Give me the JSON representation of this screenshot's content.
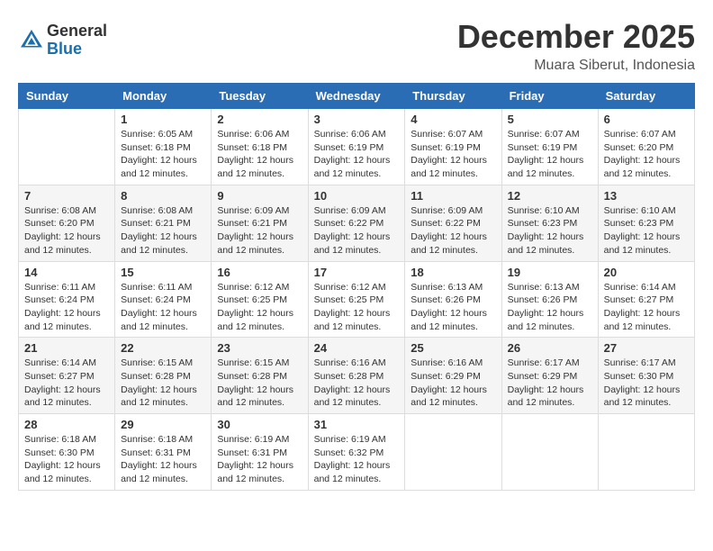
{
  "header": {
    "logo": {
      "general": "General",
      "blue": "Blue"
    },
    "title": "December 2025",
    "location": "Muara Siberut, Indonesia"
  },
  "columns": [
    "Sunday",
    "Monday",
    "Tuesday",
    "Wednesday",
    "Thursday",
    "Friday",
    "Saturday"
  ],
  "weeks": [
    [
      {
        "day": "",
        "info": ""
      },
      {
        "day": "1",
        "info": "Sunrise: 6:05 AM\nSunset: 6:18 PM\nDaylight: 12 hours\nand 12 minutes."
      },
      {
        "day": "2",
        "info": "Sunrise: 6:06 AM\nSunset: 6:18 PM\nDaylight: 12 hours\nand 12 minutes."
      },
      {
        "day": "3",
        "info": "Sunrise: 6:06 AM\nSunset: 6:19 PM\nDaylight: 12 hours\nand 12 minutes."
      },
      {
        "day": "4",
        "info": "Sunrise: 6:07 AM\nSunset: 6:19 PM\nDaylight: 12 hours\nand 12 minutes."
      },
      {
        "day": "5",
        "info": "Sunrise: 6:07 AM\nSunset: 6:19 PM\nDaylight: 12 hours\nand 12 minutes."
      },
      {
        "day": "6",
        "info": "Sunrise: 6:07 AM\nSunset: 6:20 PM\nDaylight: 12 hours\nand 12 minutes."
      }
    ],
    [
      {
        "day": "7",
        "info": "Sunrise: 6:08 AM\nSunset: 6:20 PM\nDaylight: 12 hours\nand 12 minutes."
      },
      {
        "day": "8",
        "info": "Sunrise: 6:08 AM\nSunset: 6:21 PM\nDaylight: 12 hours\nand 12 minutes."
      },
      {
        "day": "9",
        "info": "Sunrise: 6:09 AM\nSunset: 6:21 PM\nDaylight: 12 hours\nand 12 minutes."
      },
      {
        "day": "10",
        "info": "Sunrise: 6:09 AM\nSunset: 6:22 PM\nDaylight: 12 hours\nand 12 minutes."
      },
      {
        "day": "11",
        "info": "Sunrise: 6:09 AM\nSunset: 6:22 PM\nDaylight: 12 hours\nand 12 minutes."
      },
      {
        "day": "12",
        "info": "Sunrise: 6:10 AM\nSunset: 6:23 PM\nDaylight: 12 hours\nand 12 minutes."
      },
      {
        "day": "13",
        "info": "Sunrise: 6:10 AM\nSunset: 6:23 PM\nDaylight: 12 hours\nand 12 minutes."
      }
    ],
    [
      {
        "day": "14",
        "info": "Sunrise: 6:11 AM\nSunset: 6:24 PM\nDaylight: 12 hours\nand 12 minutes."
      },
      {
        "day": "15",
        "info": "Sunrise: 6:11 AM\nSunset: 6:24 PM\nDaylight: 12 hours\nand 12 minutes."
      },
      {
        "day": "16",
        "info": "Sunrise: 6:12 AM\nSunset: 6:25 PM\nDaylight: 12 hours\nand 12 minutes."
      },
      {
        "day": "17",
        "info": "Sunrise: 6:12 AM\nSunset: 6:25 PM\nDaylight: 12 hours\nand 12 minutes."
      },
      {
        "day": "18",
        "info": "Sunrise: 6:13 AM\nSunset: 6:26 PM\nDaylight: 12 hours\nand 12 minutes."
      },
      {
        "day": "19",
        "info": "Sunrise: 6:13 AM\nSunset: 6:26 PM\nDaylight: 12 hours\nand 12 minutes."
      },
      {
        "day": "20",
        "info": "Sunrise: 6:14 AM\nSunset: 6:27 PM\nDaylight: 12 hours\nand 12 minutes."
      }
    ],
    [
      {
        "day": "21",
        "info": "Sunrise: 6:14 AM\nSunset: 6:27 PM\nDaylight: 12 hours\nand 12 minutes."
      },
      {
        "day": "22",
        "info": "Sunrise: 6:15 AM\nSunset: 6:28 PM\nDaylight: 12 hours\nand 12 minutes."
      },
      {
        "day": "23",
        "info": "Sunrise: 6:15 AM\nSunset: 6:28 PM\nDaylight: 12 hours\nand 12 minutes."
      },
      {
        "day": "24",
        "info": "Sunrise: 6:16 AM\nSunset: 6:28 PM\nDaylight: 12 hours\nand 12 minutes."
      },
      {
        "day": "25",
        "info": "Sunrise: 6:16 AM\nSunset: 6:29 PM\nDaylight: 12 hours\nand 12 minutes."
      },
      {
        "day": "26",
        "info": "Sunrise: 6:17 AM\nSunset: 6:29 PM\nDaylight: 12 hours\nand 12 minutes."
      },
      {
        "day": "27",
        "info": "Sunrise: 6:17 AM\nSunset: 6:30 PM\nDaylight: 12 hours\nand 12 minutes."
      }
    ],
    [
      {
        "day": "28",
        "info": "Sunrise: 6:18 AM\nSunset: 6:30 PM\nDaylight: 12 hours\nand 12 minutes."
      },
      {
        "day": "29",
        "info": "Sunrise: 6:18 AM\nSunset: 6:31 PM\nDaylight: 12 hours\nand 12 minutes."
      },
      {
        "day": "30",
        "info": "Sunrise: 6:19 AM\nSunset: 6:31 PM\nDaylight: 12 hours\nand 12 minutes."
      },
      {
        "day": "31",
        "info": "Sunrise: 6:19 AM\nSunset: 6:32 PM\nDaylight: 12 hours\nand 12 minutes."
      },
      {
        "day": "",
        "info": ""
      },
      {
        "day": "",
        "info": ""
      },
      {
        "day": "",
        "info": ""
      }
    ]
  ]
}
